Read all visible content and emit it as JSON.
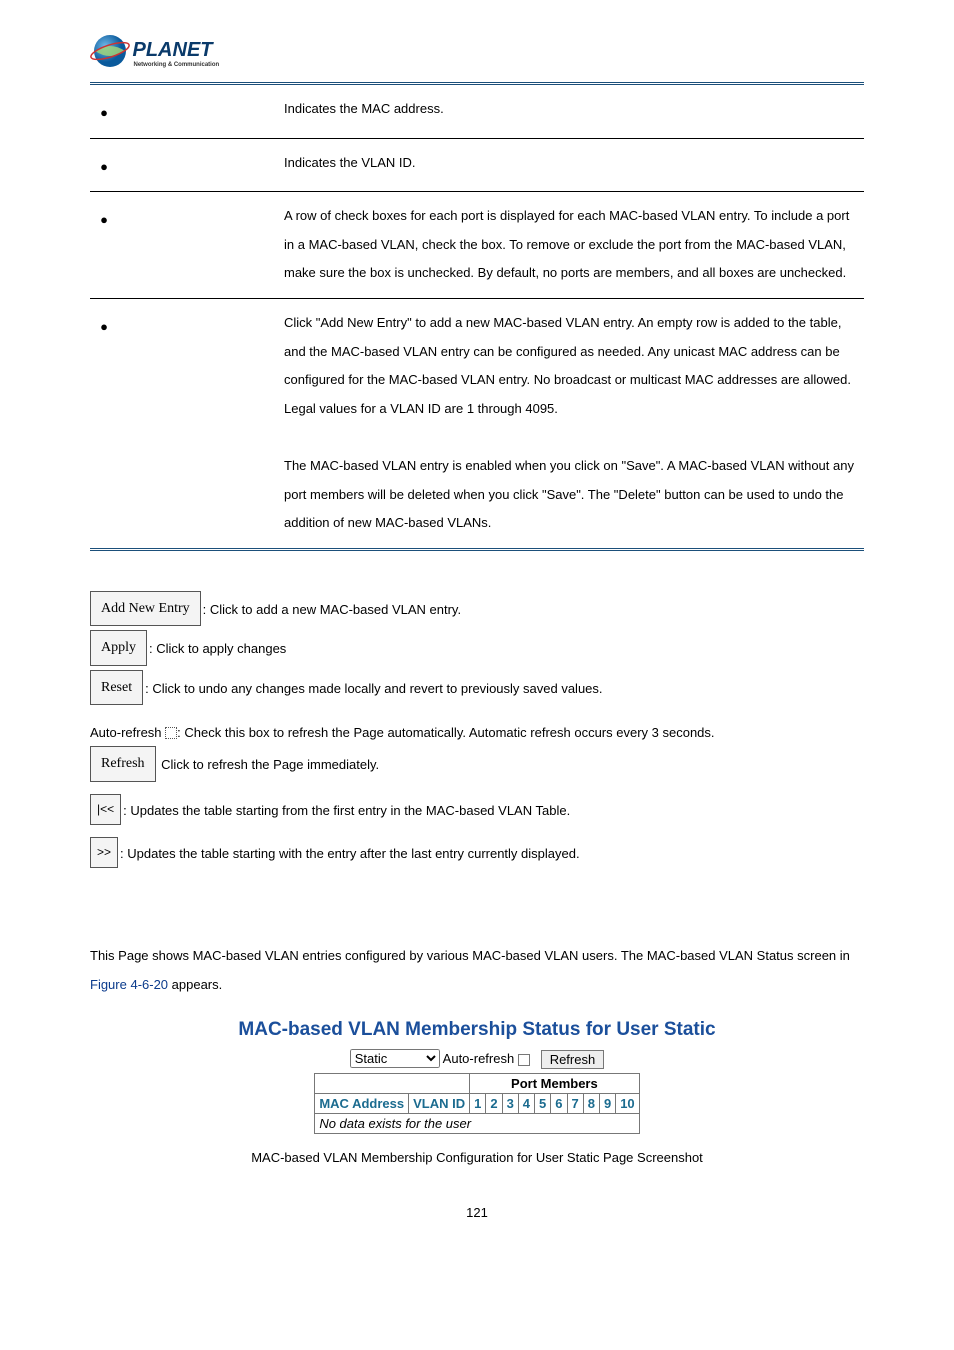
{
  "logo": {
    "brand": "PLANET",
    "tagline": "Networking & Communication"
  },
  "table": {
    "rows": [
      {
        "text": "Indicates the MAC address."
      },
      {
        "text": "Indicates the VLAN ID."
      },
      {
        "text": "A row of check boxes for each port is displayed for each MAC-based VLAN entry. To include a port in a MAC-based VLAN, check the box. To remove or exclude the port from the MAC-based VLAN, make sure the box is unchecked. By default, no ports are members, and all boxes are unchecked."
      },
      {
        "text": "Click \"Add New Entry\" to add a new MAC-based VLAN entry. An empty row is added to the table, and the MAC-based VLAN entry can be configured as needed. Any unicast MAC address can be configured for the MAC-based VLAN entry. No broadcast or multicast MAC addresses are allowed. Legal values for a VLAN ID are 1 through 4095.",
        "text2": "The MAC-based VLAN entry is enabled when you click on \"Save\". A MAC-based VLAN without any port members will be deleted when you click \"Save\". The \"Delete\" button can be used to undo the addition of new MAC-based VLANs."
      }
    ]
  },
  "buttons": {
    "addnew": {
      "label": "Add New Entry",
      "desc": ": Click to add a new MAC-based VLAN entry."
    },
    "apply": {
      "label": "Apply",
      "desc": ": Click to apply changes"
    },
    "reset": {
      "label": "Reset",
      "desc": ": Click to undo any changes made locally and revert to previously saved values."
    },
    "autorefresh": {
      "prefix": "Auto-refresh",
      "desc": ": Check this box to refresh the Page automatically. Automatic refresh occurs every 3 seconds."
    },
    "refresh": {
      "label": "Refresh",
      "desc": " Click to refresh the Page immediately."
    },
    "first": {
      "label": "|<<",
      "desc": ": Updates the table starting from the first entry in the MAC-based VLAN Table."
    },
    "next": {
      "label": ">>",
      "desc": ": Updates the table starting with the entry after the last entry currently displayed."
    }
  },
  "section": {
    "intro1": "This Page shows MAC-based VLAN entries configured by various MAC-based VLAN users. The MAC-based VLAN Status screen in ",
    "figref": "Figure 4-6-20",
    "intro2": " appears."
  },
  "status": {
    "title": "MAC-based VLAN Membership Status for User Static",
    "select_value": "Static",
    "auto_label": "Auto-refresh",
    "refresh_label": "Refresh",
    "group_blank": "",
    "group_port": "Port Members",
    "col_mac": "MAC Address",
    "col_vlan": "VLAN ID",
    "ports": [
      "1",
      "2",
      "3",
      "4",
      "5",
      "6",
      "7",
      "8",
      "9",
      "10"
    ],
    "nodata": "No data exists for the user"
  },
  "caption": "MAC-based VLAN Membership Configuration for User Static Page Screenshot",
  "pagenum": "121"
}
